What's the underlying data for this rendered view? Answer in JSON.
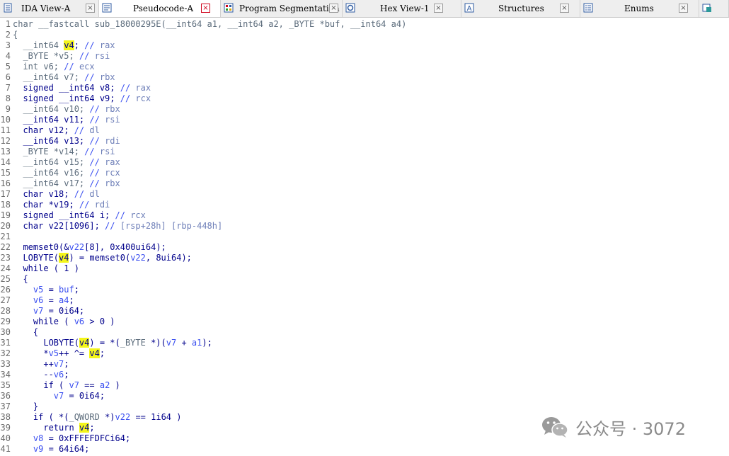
{
  "tabs": [
    {
      "label": "IDA View-A",
      "icon": "ida-view-icon",
      "active": false
    },
    {
      "label": "Pseudocode-A",
      "icon": "pseudocode-icon",
      "active": true
    },
    {
      "label": "Program Segmentation",
      "icon": "program-segmentation-icon",
      "active": false
    },
    {
      "label": "Hex View-1",
      "icon": "hex-view-icon",
      "active": false
    },
    {
      "label": "Structures",
      "icon": "structures-icon",
      "active": false
    },
    {
      "label": "Enums",
      "icon": "enums-icon",
      "active": false
    },
    {
      "label": "",
      "icon": "imports-icon",
      "active": false
    }
  ],
  "close_glyph": "×",
  "colors": {
    "highlight": "#f4f51a",
    "code": "#00008b",
    "variable": "#3a4ff0",
    "register_comment": "#6e7fb8",
    "active_tab_close": "#d0021b"
  },
  "code_lines": [
    {
      "n": "1",
      "s": [
        [
          "decl",
          "char __fastcall sub_18000295E(__int64 a1, __int64 a2, _BYTE *buf, __int64 a4)"
        ]
      ]
    },
    {
      "n": "2",
      "s": [
        [
          "decl",
          "{"
        ]
      ]
    },
    {
      "n": "3",
      "s": [
        [
          "decl",
          "  __int64 "
        ],
        [
          "hl",
          "v4"
        ],
        [
          "p",
          "; "
        ],
        [
          "cmt",
          "// "
        ],
        [
          "reg",
          "rax"
        ]
      ]
    },
    {
      "n": "4",
      "s": [
        [
          "decl",
          "  _BYTE *v5; "
        ],
        [
          "cmt",
          "// "
        ],
        [
          "reg",
          "rsi"
        ]
      ]
    },
    {
      "n": "5",
      "s": [
        [
          "decl",
          "  int v6; "
        ],
        [
          "cmt",
          "// "
        ],
        [
          "reg",
          "ecx"
        ]
      ]
    },
    {
      "n": "6",
      "s": [
        [
          "decl",
          "  __int64 v7; "
        ],
        [
          "cmt",
          "// "
        ],
        [
          "reg",
          "rbx"
        ]
      ]
    },
    {
      "n": "7",
      "s": [
        [
          "p",
          "  signed __int64 v8; "
        ],
        [
          "cmt",
          "// "
        ],
        [
          "reg",
          "rax"
        ]
      ]
    },
    {
      "n": "8",
      "s": [
        [
          "p",
          "  signed __int64 v9; "
        ],
        [
          "cmt",
          "// "
        ],
        [
          "reg",
          "rcx"
        ]
      ]
    },
    {
      "n": "9",
      "s": [
        [
          "decl",
          "  __int64 v10; "
        ],
        [
          "cmt",
          "// "
        ],
        [
          "reg",
          "rbx"
        ]
      ]
    },
    {
      "n": "10",
      "s": [
        [
          "p",
          "  __int64 v11; "
        ],
        [
          "cmt",
          "// "
        ],
        [
          "reg",
          "rsi"
        ]
      ]
    },
    {
      "n": "11",
      "s": [
        [
          "p",
          "  char v12; "
        ],
        [
          "cmt",
          "// "
        ],
        [
          "reg",
          "dl"
        ]
      ]
    },
    {
      "n": "12",
      "s": [
        [
          "p",
          "  __int64 v13; "
        ],
        [
          "cmt",
          "// "
        ],
        [
          "reg",
          "rdi"
        ]
      ]
    },
    {
      "n": "13",
      "s": [
        [
          "decl",
          "  _BYTE *v14; "
        ],
        [
          "cmt",
          "// "
        ],
        [
          "reg",
          "rsi"
        ]
      ]
    },
    {
      "n": "14",
      "s": [
        [
          "decl",
          "  __int64 v15; "
        ],
        [
          "cmt",
          "// "
        ],
        [
          "reg",
          "rax"
        ]
      ]
    },
    {
      "n": "15",
      "s": [
        [
          "decl",
          "  __int64 v16; "
        ],
        [
          "cmt",
          "// "
        ],
        [
          "reg",
          "rcx"
        ]
      ]
    },
    {
      "n": "16",
      "s": [
        [
          "decl",
          "  __int64 v17; "
        ],
        [
          "cmt",
          "// "
        ],
        [
          "reg",
          "rbx"
        ]
      ]
    },
    {
      "n": "17",
      "s": [
        [
          "p",
          "  char v18; "
        ],
        [
          "cmt",
          "// "
        ],
        [
          "reg",
          "dl"
        ]
      ]
    },
    {
      "n": "18",
      "s": [
        [
          "p",
          "  char *v19; "
        ],
        [
          "cmt",
          "// "
        ],
        [
          "reg",
          "rdi"
        ]
      ]
    },
    {
      "n": "19",
      "s": [
        [
          "p",
          "  signed __int64 i; "
        ],
        [
          "cmt",
          "// "
        ],
        [
          "reg",
          "rcx"
        ]
      ]
    },
    {
      "n": "20",
      "s": [
        [
          "p",
          "  char v22[1096]; "
        ],
        [
          "cmt",
          "// "
        ],
        [
          "reg",
          "[rsp+28h] [rbp-448h]"
        ]
      ]
    },
    {
      "n": "21",
      "s": []
    },
    {
      "n": "22",
      "s": [
        [
          "p",
          "  memset0(&"
        ],
        [
          "var",
          "v22"
        ],
        [
          "p",
          "[8], 0x400ui64);"
        ]
      ]
    },
    {
      "n": "23",
      "s": [
        [
          "p",
          "  LOBYTE("
        ],
        [
          "hl",
          "v4"
        ],
        [
          "p",
          ") = memset0("
        ],
        [
          "var",
          "v22"
        ],
        [
          "p",
          ", 8ui64);"
        ]
      ]
    },
    {
      "n": "24",
      "s": [
        [
          "p",
          "  while ( 1 )"
        ]
      ]
    },
    {
      "n": "25",
      "s": [
        [
          "p",
          "  {"
        ]
      ]
    },
    {
      "n": "26",
      "s": [
        [
          "var",
          "    v5"
        ],
        [
          "p",
          " = "
        ],
        [
          "var",
          "buf"
        ],
        [
          "p",
          ";"
        ]
      ]
    },
    {
      "n": "27",
      "s": [
        [
          "var",
          "    v6"
        ],
        [
          "p",
          " = "
        ],
        [
          "var",
          "a4"
        ],
        [
          "p",
          ";"
        ]
      ]
    },
    {
      "n": "28",
      "s": [
        [
          "var",
          "    v7"
        ],
        [
          "p",
          " = 0i64;"
        ]
      ]
    },
    {
      "n": "29",
      "s": [
        [
          "p",
          "    while ( "
        ],
        [
          "var",
          "v6"
        ],
        [
          "p",
          " > 0 )"
        ]
      ]
    },
    {
      "n": "30",
      "s": [
        [
          "p",
          "    {"
        ]
      ]
    },
    {
      "n": "31",
      "s": [
        [
          "p",
          "      LOBYTE("
        ],
        [
          "hl",
          "v4"
        ],
        [
          "p",
          ") = *("
        ],
        [
          "decl",
          "_BYTE"
        ],
        [
          "p",
          " *)("
        ],
        [
          "var",
          "v7"
        ],
        [
          "p",
          " + "
        ],
        [
          "var",
          "a1"
        ],
        [
          "p",
          ");"
        ]
      ]
    },
    {
      "n": "32",
      "s": [
        [
          "p",
          "      *"
        ],
        [
          "var",
          "v5"
        ],
        [
          "p",
          "++ ^= "
        ],
        [
          "hl",
          "v4"
        ],
        [
          "p",
          ";"
        ]
      ]
    },
    {
      "n": "33",
      "s": [
        [
          "p",
          "      ++"
        ],
        [
          "var",
          "v7"
        ],
        [
          "p",
          ";"
        ]
      ]
    },
    {
      "n": "34",
      "s": [
        [
          "p",
          "      --"
        ],
        [
          "var",
          "v6"
        ],
        [
          "p",
          ";"
        ]
      ]
    },
    {
      "n": "35",
      "s": [
        [
          "p",
          "      if ( "
        ],
        [
          "var",
          "v7"
        ],
        [
          "p",
          " == "
        ],
        [
          "var",
          "a2"
        ],
        [
          "p",
          " )"
        ]
      ]
    },
    {
      "n": "36",
      "s": [
        [
          "var",
          "        v7"
        ],
        [
          "p",
          " = 0i64;"
        ]
      ]
    },
    {
      "n": "37",
      "s": [
        [
          "p",
          "    }"
        ]
      ]
    },
    {
      "n": "38",
      "s": [
        [
          "p",
          "    if ( *("
        ],
        [
          "decl",
          "_QWORD"
        ],
        [
          "p",
          " *)"
        ],
        [
          "var",
          "v22"
        ],
        [
          "p",
          " == 1i64 )"
        ]
      ]
    },
    {
      "n": "39",
      "s": [
        [
          "p",
          "      return "
        ],
        [
          "hl",
          "v4"
        ],
        [
          "p",
          ";"
        ]
      ]
    },
    {
      "n": "40",
      "s": [
        [
          "var",
          "    v8"
        ],
        [
          "p",
          " = 0xFFFEFDFCi64;"
        ]
      ]
    },
    {
      "n": "41",
      "s": [
        [
          "var",
          "    v9"
        ],
        [
          "p",
          " = 64i64;"
        ]
      ]
    }
  ],
  "watermark": {
    "text": "公众号 · 3072",
    "icon": "wechat-icon"
  }
}
